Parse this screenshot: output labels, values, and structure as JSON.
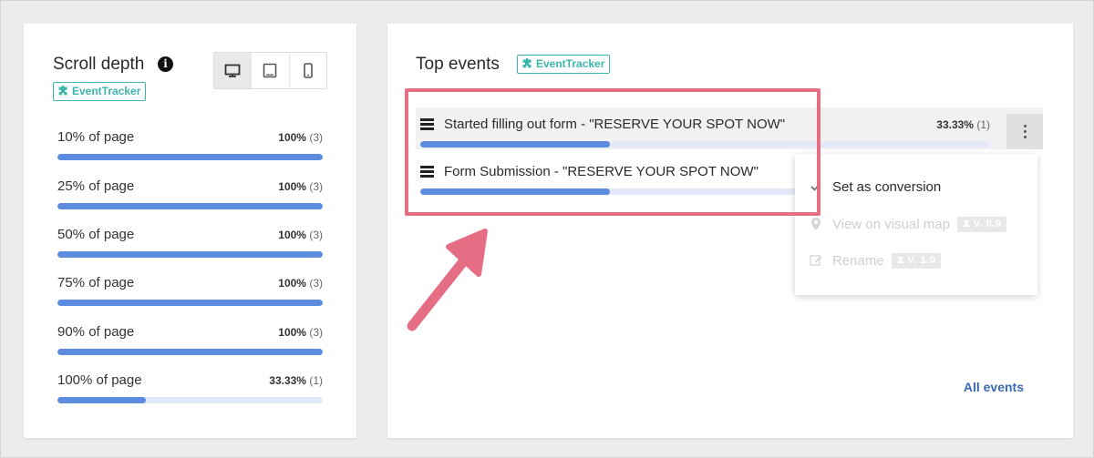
{
  "scroll_depth": {
    "title": "Scroll depth",
    "info_icon": "info-icon",
    "badge": "EventTracker",
    "devices": [
      {
        "name": "desktop",
        "icon": "desktop-icon",
        "active": true
      },
      {
        "name": "tablet",
        "icon": "tablet-icon",
        "active": false
      },
      {
        "name": "mobile",
        "icon": "mobile-icon",
        "active": false
      }
    ],
    "rows": [
      {
        "label": "10% of page",
        "percent": "100%",
        "count": "(3)",
        "fill": 1.0
      },
      {
        "label": "25% of page",
        "percent": "100%",
        "count": "(3)",
        "fill": 1.0
      },
      {
        "label": "50% of page",
        "percent": "100%",
        "count": "(3)",
        "fill": 1.0
      },
      {
        "label": "75% of page",
        "percent": "100%",
        "count": "(3)",
        "fill": 1.0
      },
      {
        "label": "90% of page",
        "percent": "100%",
        "count": "(3)",
        "fill": 1.0
      },
      {
        "label": "100% of page",
        "percent": "33.33%",
        "count": "(1)",
        "fill": 0.3333
      }
    ]
  },
  "top_events": {
    "title": "Top events",
    "badge": "EventTracker",
    "events": [
      {
        "label": "Started filling out form - \"RESERVE YOUR SPOT NOW\"",
        "percent": "33.33%",
        "count": "(1)",
        "fill": 0.3333
      },
      {
        "label": "Form Submission - \"RESERVE YOUR SPOT NOW\"",
        "fill": 0.3333
      }
    ],
    "menu": [
      {
        "label": "Set as conversion",
        "icon": "check-icon",
        "enabled": true
      },
      {
        "label": "View on visual map",
        "icon": "map-pin-icon",
        "enabled": false,
        "version": "V. 0.9"
      },
      {
        "label": "Rename",
        "icon": "edit-icon",
        "enabled": false,
        "version": "V. 1.0"
      }
    ],
    "all_events_link": "All events"
  },
  "colors": {
    "accent_teal": "#3db6ad",
    "bar_fill": "#5b8ce0",
    "bar_track": "#e3e9f8",
    "highlight": "#e56e85",
    "link": "#3a6ab4"
  }
}
